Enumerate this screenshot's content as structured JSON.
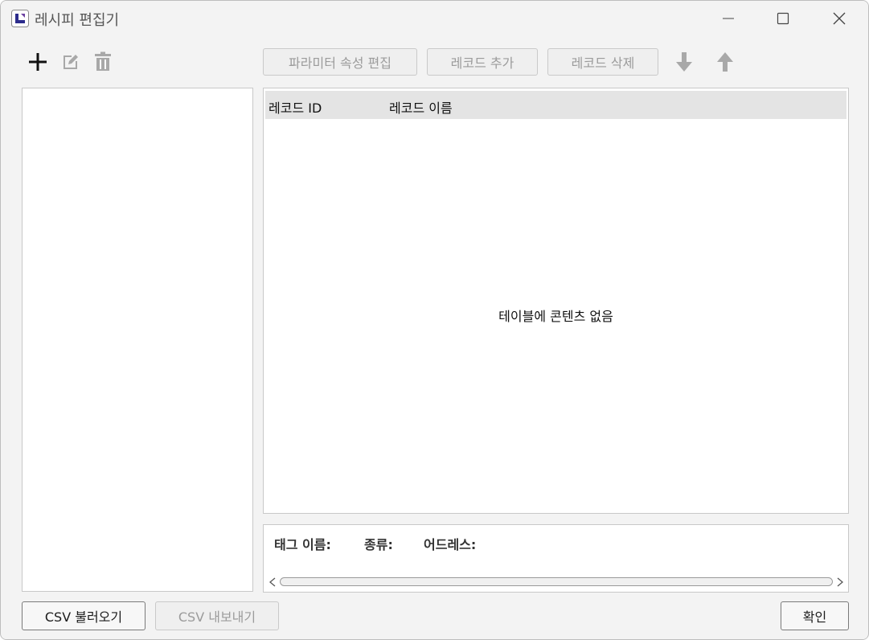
{
  "window": {
    "title": "레시피 편집기"
  },
  "toolbar": {
    "add_icon": "plus-icon",
    "edit_icon": "edit-icon",
    "delete_icon": "trash-icon",
    "param_edit_label": "파라미터 속성 편집",
    "add_record_label": "레코드 추가",
    "delete_record_label": "레코드 삭제",
    "move_down_icon": "arrow-down-icon",
    "move_up_icon": "arrow-up-icon"
  },
  "table": {
    "columns": [
      "레코드 ID",
      "레코드 이름"
    ],
    "empty_message": "테이블에 콘텐츠 없음"
  },
  "info": {
    "tag_name_label": "태그 이름:",
    "type_label": "종류:",
    "address_label": "어드레스:"
  },
  "footer": {
    "csv_import_label": "CSV 불러오기",
    "csv_export_label": "CSV 내보내기",
    "confirm_label": "확인"
  },
  "colors": {
    "window_bg": "#f3f3f3",
    "header_bg": "#e4e4e4",
    "disabled_text": "#9b9b9b"
  }
}
